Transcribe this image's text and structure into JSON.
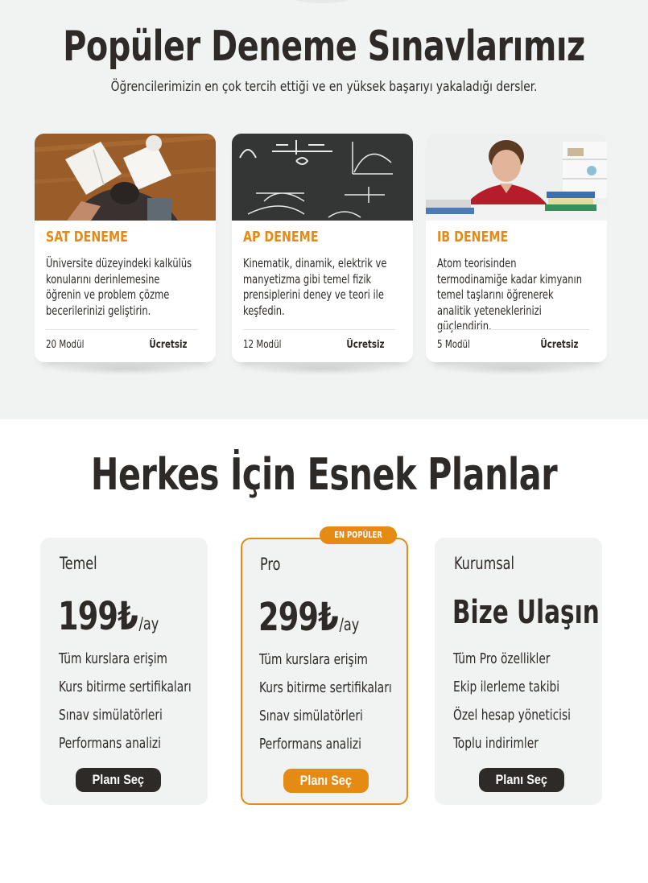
{
  "courses": {
    "title": "Popüler Deneme Sınavlarımız",
    "subtitle": "Öğrencilerimizin en çok tercih ettiği ve en yüksek başarıyı yakaladığı dersler.",
    "items": [
      {
        "tag": "SAT DENEME",
        "description": "Üniversite düzeyindeki kalkülüs konularını derinlemesine öğrenin ve problem çözme becerilerinizi geliştirin.",
        "modules": "20 Modül",
        "price": "Ücretsiz"
      },
      {
        "tag": "AP DENEME",
        "description": "Kinematik, dinamik, elektrik ve manyetizma gibi temel fizik prensiplerini deney ve teori ile keşfedin.",
        "modules": "12 Modül",
        "price": "Ücretsiz"
      },
      {
        "tag": "IB DENEME",
        "description": "Atom teorisinden termodinamiğe kadar kimyanın temel taşlarını öğrenerek analitik yeteneklerinizi güçlendirin.",
        "modules": "5 Modül",
        "price": "Ücretsiz"
      }
    ]
  },
  "pricing": {
    "title": "Herkes İçin Esnek Planlar",
    "badge": "EN POPÜLER",
    "plans": [
      {
        "name": "Temel",
        "price": "199₺",
        "period": "/ay",
        "features": [
          "Tüm kurslara erişim",
          "Kurs bitirme sertifikaları",
          "Sınav simülatörleri",
          "Performans analizi"
        ],
        "button": "Planı Seç"
      },
      {
        "name": "Pro",
        "price": "299₺",
        "period": "/ay",
        "features": [
          "Tüm kurslara erişim",
          "Kurs bitirme sertifikaları",
          "Sınav simülatörleri",
          "Performans analizi"
        ],
        "button": "Planı Seç"
      },
      {
        "name": "Kurumsal",
        "price": "Bize Ulaşın",
        "features": [
          "Tüm Pro özellikler",
          "Ekip ilerleme takibi",
          "Özel hesap yöneticisi",
          "Toplu indirimler"
        ],
        "button": "Planı Seç"
      }
    ]
  },
  "colors": {
    "accent": "#e58a13",
    "dark": "#2d2a27",
    "panel": "#f1f2f2"
  }
}
